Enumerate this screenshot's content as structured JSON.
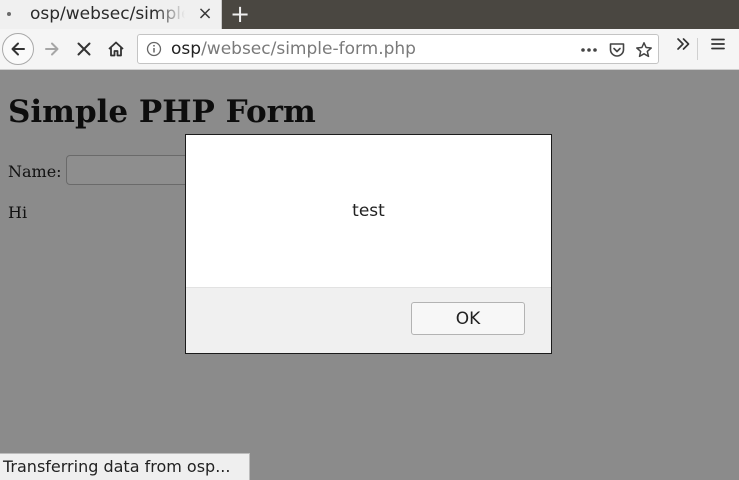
{
  "browser": {
    "tab": {
      "title": "osp/websec/simple-form.php",
      "close_label": "×"
    },
    "new_tab_label": "+",
    "url": {
      "host": "osp",
      "path": "/websec/simple-form.php"
    },
    "status_text": "Transferring data from osp..."
  },
  "page": {
    "title": "Simple PHP Form",
    "name_label": "Name:",
    "name_value": "",
    "greeting": "Hi"
  },
  "dialog": {
    "message": "test",
    "ok_label": "OK"
  }
}
